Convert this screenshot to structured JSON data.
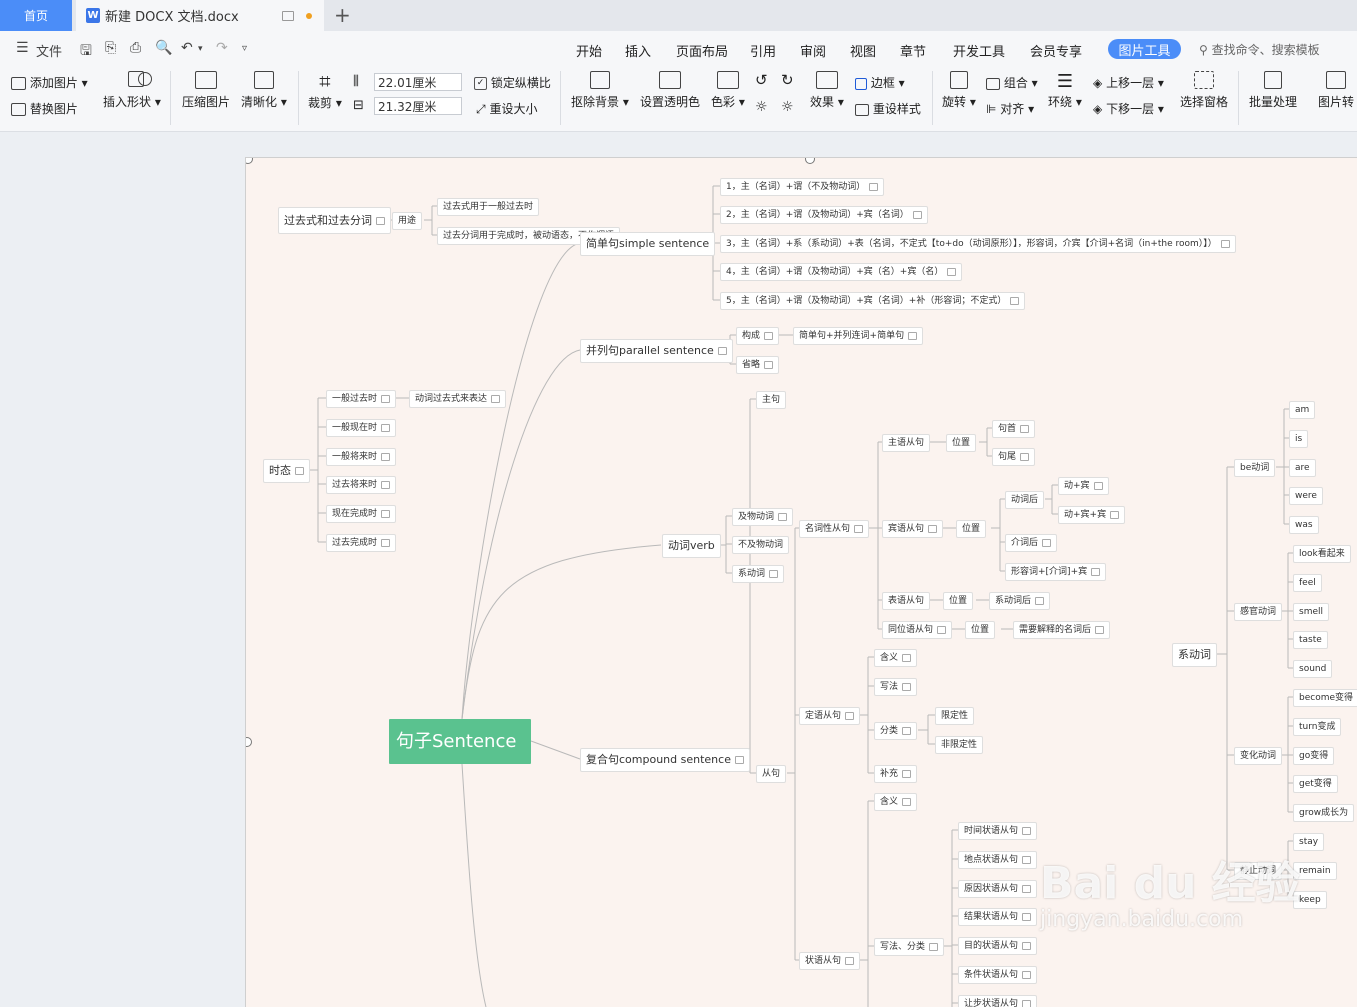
{
  "tabs": {
    "home": "首页",
    "doc": "新建 DOCX 文档.docx",
    "new_tab": "+"
  },
  "menu": {
    "file": "文件",
    "items": [
      "开始",
      "插入",
      "页面布局",
      "引用",
      "审阅",
      "视图",
      "章节",
      "开发工具",
      "会员专享"
    ],
    "active": "图片工具",
    "search": "查找命令、搜索模板"
  },
  "ribbon": {
    "add_image": "添加图片",
    "replace_image": "替换图片",
    "insert_shape": "插入形状",
    "compress": "压缩图片",
    "sharpen": "清晰化",
    "crop": "裁剪",
    "width": "22.01厘米",
    "height": "21.32厘米",
    "lock_ratio": "锁定纵横比",
    "reset_size": "重设大小",
    "remove_bg": "抠除背景",
    "set_transparent": "设置透明色",
    "color": "色彩",
    "border": "边框",
    "effect": "效果",
    "reset_style": "重设样式",
    "rotate": "旋转",
    "group": "组合",
    "align": "对齐",
    "wrap": "环绕",
    "bring_forward": "上移一层",
    "send_backward": "下移一层",
    "selection_pane": "选择窗格",
    "batch": "批量处理",
    "convert": "图片转"
  },
  "mindmap": {
    "root": "句子Sentence",
    "past": {
      "label": "过去式和过去分词",
      "usage": "用途",
      "u1": "过去式用于一般过去时",
      "u2": "过去分词用于完成时，被动语态，不作谓语"
    },
    "simple": {
      "label": "简单句simple sentence",
      "items": [
        "1，主（名词）+谓（不及物动词）",
        "2，主（名词）+谓（及物动词）+宾（名词）",
        "3，主（名词）+系（系动词）+表（名词，不定式【to+do（动词原形）】，形容词，介宾【介词+名词（in+the room）】）",
        "4，主（名词）+谓（及物动词）+宾（名）+宾（名）",
        "5，主（名词）+谓（及物动词）+宾（名词）+补（形容词；不定式）"
      ]
    },
    "parallel": {
      "label": "并列句parallel sentence",
      "compose": "构成",
      "compose_val": "简单句+并列连词+简单句",
      "omit": "省略"
    },
    "tense": {
      "label": "时态",
      "expr": "动词过去式来表达",
      "items": [
        "一般过去时",
        "一般现在时",
        "一般将来时",
        "过去将来时",
        "现在完成时",
        "过去完成时"
      ]
    },
    "verb": {
      "label": "动词verb",
      "items": [
        "及物动词",
        "不及物动词",
        "系动词"
      ]
    },
    "compound": {
      "label": "复合句compound sentence",
      "main": "主句",
      "sub": "从句"
    },
    "noun_clause": "名词性从句",
    "subject_clause": "主语从句",
    "position": "位置",
    "head": "句首",
    "tail": "句尾",
    "object_clause": "宾语从句",
    "after_verb": "动词后",
    "v_o": "动+宾",
    "v_o_o": "动+宾+宾",
    "after_prep": "介词后",
    "adj_prep_o": "形容词+[介词]+宾",
    "predicative_clause": "表语从句",
    "after_linking": "系动词后",
    "appositive_clause": "同位语从句",
    "after_noun": "需要解释的名词后",
    "attributive_clause": "定语从句",
    "meaning": "含义",
    "form": "写法",
    "category": "分类",
    "restrictive": "限定性",
    "nonrestrictive": "非限定性",
    "supplement": "补充",
    "adverbial_clause": "状语从句",
    "form_category": "写法、分类",
    "adverbials": [
      "时间状语从句",
      "地点状语从句",
      "原因状语从句",
      "结果状语从句",
      "目的状语从句",
      "条件状语从句",
      "让步状语从句"
    ],
    "linking": {
      "label": "系动词",
      "be": {
        "label": "be动词",
        "items": [
          "am",
          "is",
          "are",
          "were",
          "was"
        ]
      },
      "sense": {
        "label": "感官动词",
        "items": [
          "look看起来",
          "feel",
          "smell",
          "taste",
          "sound"
        ]
      },
      "change": {
        "label": "变化动词",
        "items": [
          "become变得",
          "turn变成",
          "go变得",
          "get变得",
          "grow成长为"
        ]
      },
      "static": {
        "label": "静止动词",
        "items": [
          "stay",
          "remain",
          "keep"
        ]
      }
    }
  },
  "watermark": {
    "brand": "Bai du 经验",
    "url": "jingyan.baidu.com"
  }
}
